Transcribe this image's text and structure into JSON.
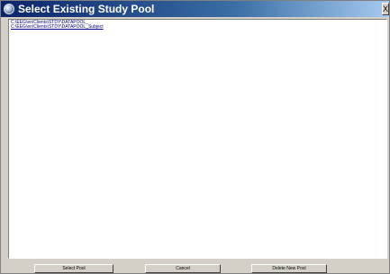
{
  "window": {
    "title": "Select Existing Study Pool",
    "close_label": "X"
  },
  "pool_list": {
    "items": [
      {
        "label": "C:\\EEG\\en\\Clients\\STDY\\DATAPOOL_"
      },
      {
        "label": "C:\\EEG\\en\\Clients\\STDY\\DATAPOOL_Subject"
      }
    ]
  },
  "buttons": {
    "select_label": "Select Pool",
    "cancel_label": "Cancel",
    "delete_label": "Delete New Pool"
  }
}
